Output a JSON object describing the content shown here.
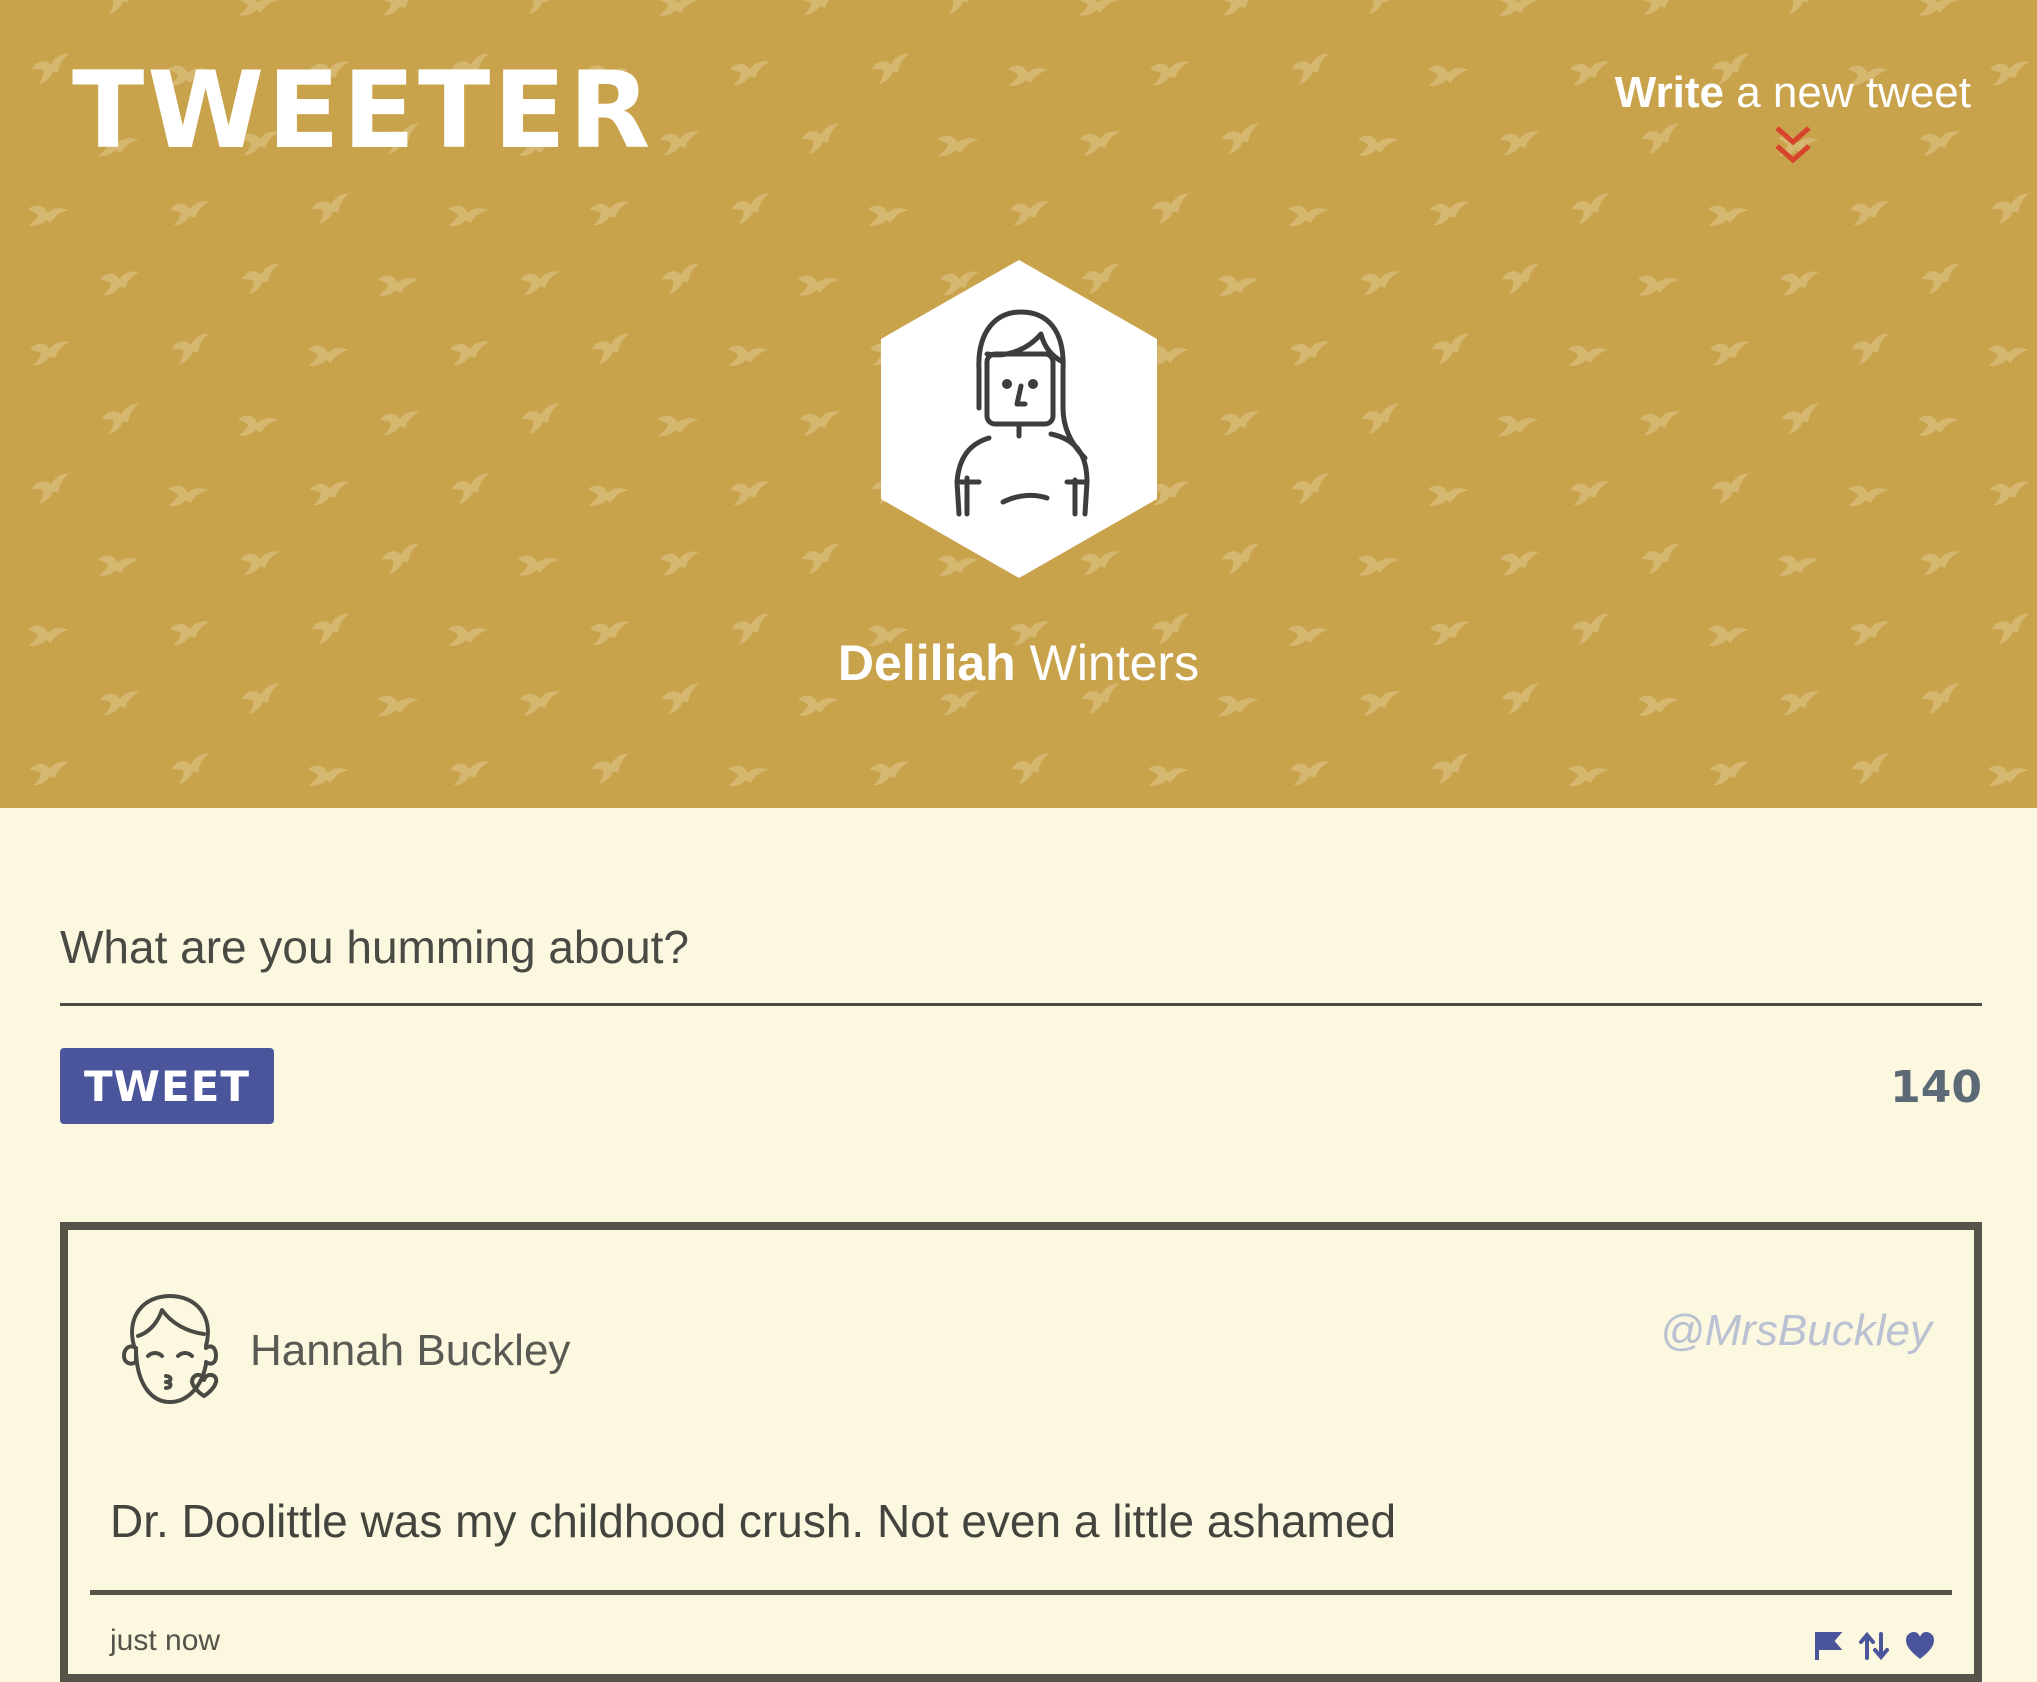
{
  "colors": {
    "header_bg": "#c9a24c",
    "page_bg": "#fcf7df",
    "accent_red": "#d8432c",
    "button_blue": "#4a559b",
    "counter_slate": "#5c6a78",
    "handle_gray": "#b9c1d2"
  },
  "header": {
    "logo": "TWEETER",
    "compose_toggle": {
      "bold": "Write",
      "rest": " a new tweet",
      "icon": "double-chevron-down-icon"
    }
  },
  "profile": {
    "avatar_icon": "woman-avatar-icon",
    "first_name": "Deliliah",
    "last_name": " Winters"
  },
  "compose": {
    "placeholder": "What are you humming about?",
    "value": "",
    "button_label": "TWEET",
    "counter": "140"
  },
  "tweets": [
    {
      "avatar_icon": "kissing-face-avatar-icon",
      "author": "Hannah Buckley",
      "handle": "@MrsBuckley",
      "text": "Dr. Doolittle was my childhood crush. Not even a little ashamed",
      "time": "just now",
      "actions": [
        "flag-icon",
        "retweet-icon",
        "heart-icon"
      ]
    }
  ]
}
